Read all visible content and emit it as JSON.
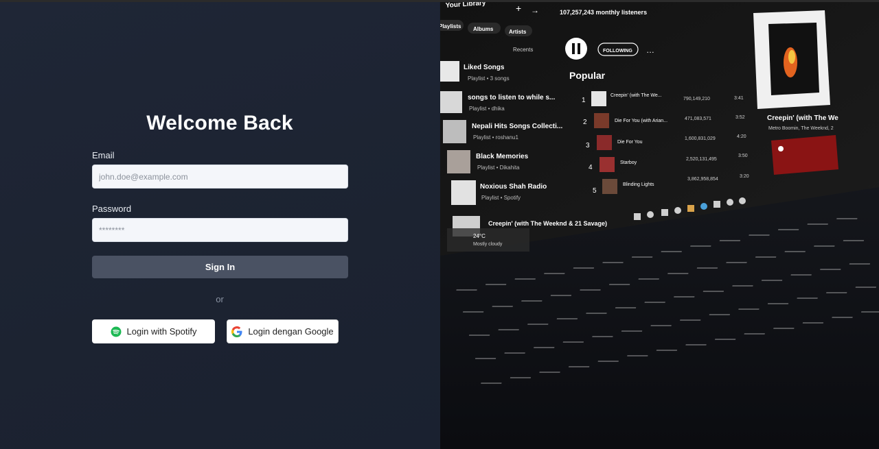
{
  "login": {
    "title": "Welcome Back",
    "email_label": "Email",
    "email_placeholder": "john.doe@example.com",
    "password_label": "Password",
    "password_placeholder": "********",
    "signin_label": "Sign In",
    "or_text": "or",
    "spotify_label": "Login with Spotify",
    "google_label": "Login dengan Google"
  },
  "hero": {
    "description": "Laptop displaying Spotify library",
    "library_title": "Your Library",
    "filters": [
      "Playlists",
      "Albums",
      "Artists"
    ],
    "sort_label": "Recents",
    "listeners": "107,257,243 monthly listeners",
    "follow_label": "FOLLOWING",
    "popular_label": "Popular",
    "library_items": [
      {
        "name": "Liked Songs",
        "sub": "Playlist • 3 songs"
      },
      {
        "name": "songs to listen to while s...",
        "sub": "Playlist • dhika"
      },
      {
        "name": "Nepali Hits Songs Collecti...",
        "sub": "Playlist • roshanu1"
      },
      {
        "name": "Black Memories",
        "sub": "Playlist • Dikahita"
      },
      {
        "name": "Noxious Shah Radio",
        "sub": "Playlist • Spotify"
      }
    ],
    "tracks": [
      {
        "num": "1",
        "title": "Creepin' (with The We...",
        "plays": "790,149,210",
        "time": "3:41"
      },
      {
        "num": "2",
        "title": "Die For You (with Arian...",
        "plays": "471,083,571",
        "time": "3:52"
      },
      {
        "num": "3",
        "title": "Die For You",
        "plays": "1,600,831,029",
        "time": "4:20"
      },
      {
        "num": "4",
        "title": "Starboy",
        "plays": "2,520,131,495",
        "time": "3:50"
      },
      {
        "num": "5",
        "title": "Blinding Lights",
        "plays": "3,862,958,854",
        "time": "3:20"
      }
    ],
    "now_playing_title": "Creepin' (with The We",
    "now_playing_artist": "Metro Boomin, The Weeknd, 2",
    "bottom_track": "Creepin' (with The Weeknd & 21 Savage)",
    "weather_temp": "24°C",
    "weather_text": "Mostly cloudy"
  },
  "colors": {
    "left_bg": "#1f2636",
    "signin_bg": "#4a5263",
    "spotify_green": "#1db954"
  }
}
